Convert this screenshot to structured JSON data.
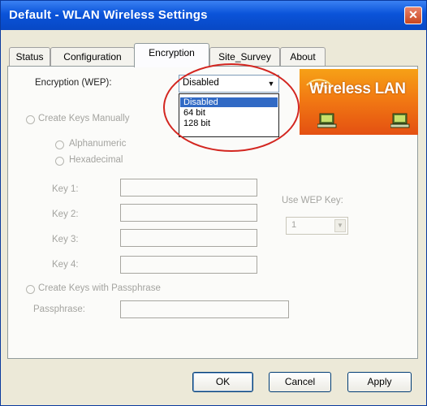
{
  "window": {
    "title": "Default - WLAN Wireless Settings",
    "close_glyph": "✕"
  },
  "tabs": [
    {
      "label": "Status"
    },
    {
      "label": "Configuration"
    },
    {
      "label": "Encryption",
      "active": true
    },
    {
      "label": "Site_Survey"
    },
    {
      "label": "About"
    }
  ],
  "encryption": {
    "label": "Encryption (WEP):",
    "selected": "Disabled",
    "options": [
      "Disabled",
      "64 bit",
      "128 bit"
    ],
    "highlighted_option": "Disabled"
  },
  "logo": {
    "text": "Wireless LAN"
  },
  "manual_keys": {
    "label": "Create Keys Manually",
    "formats": [
      "Alphanumeric",
      "Hexadecimal"
    ],
    "key_labels": [
      "Key 1:",
      "Key 2:",
      "Key 3:",
      "Key 4:"
    ]
  },
  "use_wep_key": {
    "label": "Use WEP Key:",
    "value": "1"
  },
  "passphrase": {
    "radio_label": "Create Keys with Passphrase",
    "field_label": "Passphrase:"
  },
  "buttons": {
    "ok": "OK",
    "cancel": "Cancel",
    "apply": "Apply"
  },
  "colors": {
    "titlebar": "#0a53d9",
    "dialog_bg": "#ece9d8",
    "selection": "#316ac5",
    "annotation_ring": "#d32620",
    "logo_orange": "#f27a13"
  }
}
